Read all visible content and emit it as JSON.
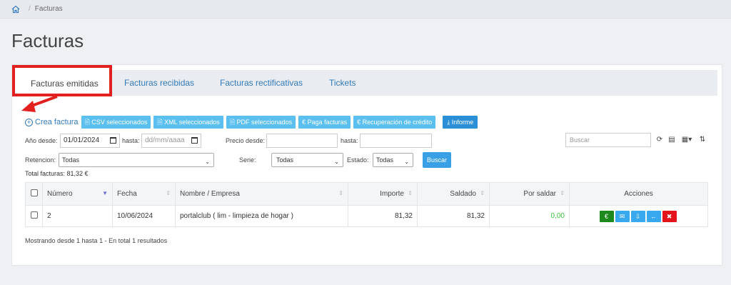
{
  "breadcrumb": {
    "current": "Facturas"
  },
  "page": {
    "title": "Facturas"
  },
  "tabs": [
    {
      "label": "Facturas emitidas"
    },
    {
      "label": "Facturas recibidas"
    },
    {
      "label": "Facturas rectificativas"
    },
    {
      "label": "Tickets"
    }
  ],
  "toolbar": {
    "create": "Crea factura",
    "csv": "CSV seleccionados",
    "xml": "XML seleccionados",
    "pdf": "PDF seleccionados",
    "paga": "Paga facturas",
    "recuperacion": "Recuperación de crédito",
    "informe": "Informe"
  },
  "filters": {
    "ano_desde_label": "Año desde:",
    "ano_desde_value": "01/01/2024",
    "hasta_label": "hasta:",
    "hasta_value": "dd/mm/aaaa",
    "precio_desde_label": "Precio desde:",
    "precio_hasta_label": "hasta:",
    "buscar_placeholder": "Buscar",
    "retencion_label": "Retencion:",
    "retencion_value": "Todas",
    "serie_label": "Serie:",
    "serie_value": "Todas",
    "estado_label": "Estado:",
    "estado_value": "Todas",
    "buscar_button": "Buscar"
  },
  "total": "Total facturas: 81,32 €",
  "table": {
    "headers": [
      "Número",
      "Fecha",
      "Nombre / Empresa",
      "Importe",
      "Saldado",
      "Por saldar",
      "Acciones"
    ],
    "rows": [
      {
        "numero": "2",
        "fecha": "10/06/2024",
        "nombre": "portalclub ( lim - limpieza de hogar )",
        "importe": "81,32",
        "saldado": "81,32",
        "por_saldar": "0,00"
      }
    ]
  },
  "footer": "Mostrando desde 1 hasta 1 - En total 1 resultados",
  "colors": {
    "accent": "#337ab7",
    "highlight": "#e32020",
    "success": "#1e8a1e",
    "danger": "#e5141c"
  }
}
